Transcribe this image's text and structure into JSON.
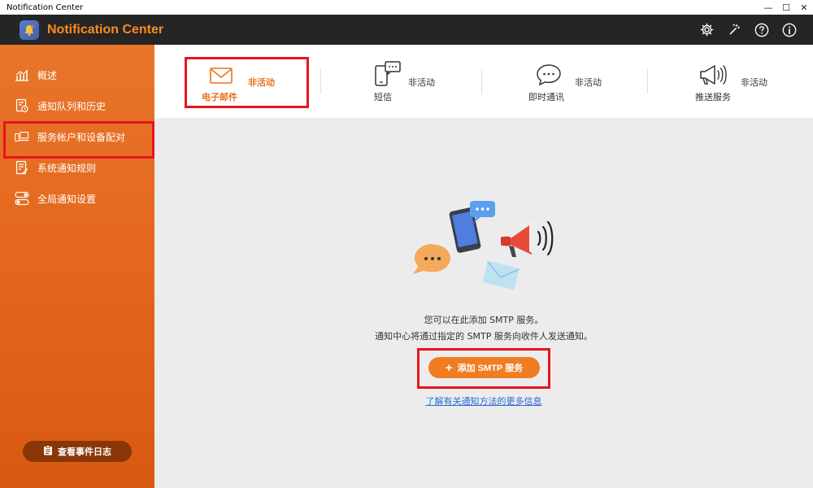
{
  "window": {
    "title": "Notification Center",
    "controls": {
      "minimize": "—",
      "maximize": "☐",
      "close": "✕"
    }
  },
  "app": {
    "title": "Notification Center",
    "actions": [
      "gear-icon",
      "magic-wand-icon",
      "help-icon",
      "info-icon"
    ]
  },
  "sidebar": {
    "items": [
      {
        "label": "概述",
        "icon": "chart-icon"
      },
      {
        "label": "通知队列和历史",
        "icon": "history-icon"
      },
      {
        "label": "服务帐户和设备配对",
        "icon": "device-pairing-icon"
      },
      {
        "label": "系统通知规则",
        "icon": "rules-icon"
      },
      {
        "label": "全局通知设置",
        "icon": "toggle-settings-icon"
      }
    ],
    "selected_index": 2,
    "event_log_button": "查看事件日志"
  },
  "tabs": [
    {
      "name": "电子邮件",
      "status": "非活动",
      "icon": "envelope-icon"
    },
    {
      "name": "短信",
      "status": "非活动",
      "icon": "phone-message-icon"
    },
    {
      "name": "即时通讯",
      "status": "非活动",
      "icon": "chat-bubble-icon"
    },
    {
      "name": "推送服务",
      "status": "非活动",
      "icon": "megaphone-icon"
    }
  ],
  "active_tab_index": 0,
  "main": {
    "message_line1": "您可以在此添加 SMTP 服务。",
    "message_line2": "通知中心将通过指定的 SMTP 服务向收件人发送通知。",
    "add_button": "添加 SMTP 服务",
    "add_button_icon": "+",
    "learn_more_link": "了解有关通知方法的更多信息"
  },
  "colors": {
    "accent": "#f07d22",
    "brand_text": "#ff8a1f",
    "header_bg": "#252525",
    "highlight_frame": "#e5161d",
    "link": "#2a6ad8"
  }
}
